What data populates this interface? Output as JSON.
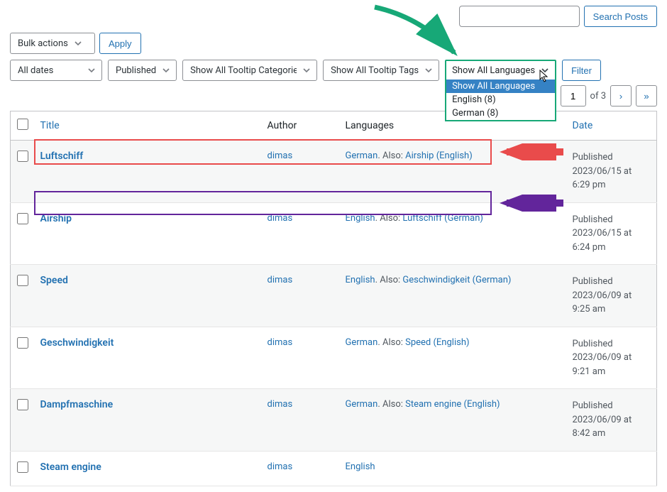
{
  "search": {
    "placeholder": "",
    "button": "Search Posts"
  },
  "bulk_actions": {
    "label": "Bulk actions",
    "apply": "Apply"
  },
  "filters": {
    "dates": "All dates",
    "status": "Published",
    "category": "Show All Tooltip Categories",
    "tags": "Show All Tooltip Tags",
    "language_selected": "Show All Languages",
    "language_options": [
      "Show All Languages",
      "English (8)",
      "German (8)"
    ],
    "filter_button": "Filter"
  },
  "pagination": {
    "current": "1",
    "of_label": "of 3",
    "next": "›",
    "last": "»"
  },
  "columns": {
    "title": "Title",
    "author": "Author",
    "languages": "Languages",
    "date": "Date"
  },
  "rows": [
    {
      "title": "Luftschiff",
      "author": "dimas",
      "lang_primary": "German",
      "also_label": ". Also: ",
      "also_link": "Airship (English)",
      "date_label": "Published",
      "date_value": "2023/06/15 at 6:29 pm"
    },
    {
      "title": "Airship",
      "author": "dimas",
      "lang_primary": "English",
      "also_label": ". Also: ",
      "also_link": "Luftschiff (German)",
      "date_label": "Published",
      "date_value": "2023/06/15 at 6:24 pm"
    },
    {
      "title": "Speed",
      "author": "dimas",
      "lang_primary": "English",
      "also_label": ". Also: ",
      "also_link": "Geschwindigkeit (German)",
      "date_label": "Published",
      "date_value": "2023/06/09 at 9:25 am"
    },
    {
      "title": "Geschwindigkeit",
      "author": "dimas",
      "lang_primary": "German",
      "also_label": ". Also: ",
      "also_link": "Speed (English)",
      "date_label": "Published",
      "date_value": "2023/06/09 at 9:21 am"
    },
    {
      "title": "Dampfmaschine",
      "author": "dimas",
      "lang_primary": "German",
      "also_label": ". Also: ",
      "also_link": "Steam engine (English)",
      "date_label": "Published",
      "date_value": "2023/06/09 at 8:42 am"
    },
    {
      "title": "Steam engine",
      "author": "dimas",
      "lang_primary": "English",
      "also_label": "",
      "also_link": "",
      "date_label": "",
      "date_value": ""
    }
  ],
  "annotations": {
    "arrow_color_red": "#e94b4b",
    "arrow_color_purple": "#62259b",
    "arrow_color_green": "#17a877"
  }
}
